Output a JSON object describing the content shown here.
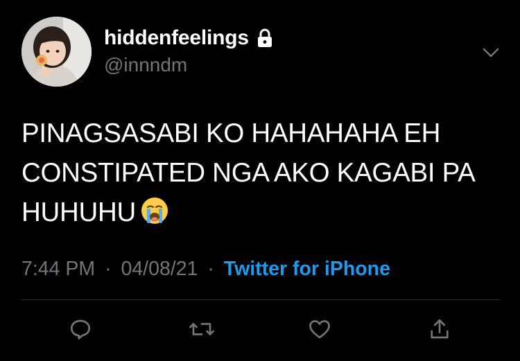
{
  "tweet": {
    "author": {
      "display_name": "hiddenfeelings",
      "handle": "@innndm",
      "protected_icon": "lock-icon",
      "avatar": "avatar"
    },
    "text_lines": [
      "PINAGSASABI KO HAHAHAHA EH",
      "CONSTIPATED NGA AKO KAGABI PA",
      "HUHUHU"
    ],
    "emoji": "loudly-crying-face-icon",
    "time": "7:44 PM",
    "date": "04/08/21",
    "separator": "·",
    "source": "Twitter for iPhone",
    "actions": [
      {
        "name": "reply",
        "icon": "reply-icon"
      },
      {
        "name": "retweet",
        "icon": "retweet-icon"
      },
      {
        "name": "like",
        "icon": "heart-icon"
      },
      {
        "name": "share",
        "icon": "share-icon"
      }
    ]
  },
  "colors": {
    "background": "#000000",
    "primary_text": "#ffffff",
    "secondary_text": "#71767b",
    "link": "#1d9bf0",
    "divider": "#2f3336"
  }
}
